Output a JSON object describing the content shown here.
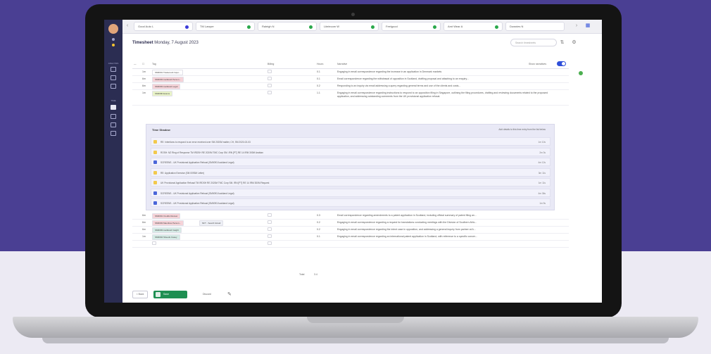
{
  "page": {
    "title_bold": "Timesheet",
    "title_date": "Monday, 7 August 2023",
    "search_placeholder": "Search timesheets"
  },
  "tabs": [
    {
      "label": "Good Auto L",
      "color": "#3b3bd9"
    },
    {
      "label": "TM Lawyer",
      "color": "#2aa84b"
    },
    {
      "label": "Raleigh N",
      "color": "#2aa84b"
    },
    {
      "label": "Litelecom W",
      "color": "#2aa84b"
    },
    {
      "label": "Feelgood",
      "color": "#2aa84b"
    },
    {
      "label": "Amt Wear A",
      "color": "#2aa84b"
    },
    {
      "label": "Downies N",
      "color": ""
    }
  ],
  "sidebar": {
    "sections": [
      "ANALYSIS",
      "TIME"
    ]
  },
  "table": {
    "headers": [
      "Tag",
      "Billing",
      "Hours",
      "Narrative"
    ],
    "toggle_label": "Show narratives",
    "rows_top": [
      {
        "n": "1m",
        "tag": "SM0001 Trademark Inqui...",
        "tag_color": "#ffffff",
        "hours": "0.1",
        "narrative": "Engaging in email correspondence regarding the increase in an application in Denmark markets"
      },
      {
        "n": "6m",
        "tag": "SM0093 Auckland Person...",
        "tag_color": "#f6d3d8",
        "hours": "0.1",
        "narrative": "Email correspondence regarding the withdrawal of opposition in Scotland, drafting proposal and attaching to an enquiry..."
      },
      {
        "n": "6m",
        "tag": "SM0093 Auckland Legal",
        "tag_color": "#f6d3d8",
        "hours": "0.2",
        "narrative": "Responding to an inquiry via email addressing a query regarding general terms and use of the clients and costs..."
      },
      {
        "n": "1m",
        "tag": "SM0090 Exams",
        "tag_color": "#e9f3c8",
        "hours": "1.1",
        "narrative": "Engaging in email correspondence regarding instructions to respond to an opposition filing in Singapore, outlining the filing procedures, drafting and reviewing documents related to the proposed application, and addressing outstanding comments from the UK provisional application refusal."
      }
    ],
    "shadow": {
      "title": "Time Shadow",
      "note": "Add details to this time entry from the list below",
      "items": [
        {
          "text": "RE: Intentions to respond to an error received over SM 2020M matter, CH, SM 2020-02-03",
          "time": "1m 10s",
          "icon_color": "#f2c94c"
        },
        {
          "text": "ROSH: NZ Ring of Response TM IRDSH RE 2020M TMC Corp SM. IRN [PT] RE 14 IRM 300M Arabian",
          "time": "2m 3s",
          "icon_color": "#f2c94c"
        },
        {
          "text": "SCREENS - UK Provisional Application Refusal (SM0093 Auckland Legal)",
          "time": "4m 12s",
          "icon_color": "#4a66d9"
        },
        {
          "text": "RE: Application Exercise (SM 0093M Letter)",
          "time": "3m 11s",
          "icon_color": "#f2c94c"
        },
        {
          "text": "UK Provisional Application Refusal TM IRDSH RE 2020M TMC Corp SM. IRN [PT] RE 14 IRM 300M Request",
          "time": "1m 11s",
          "icon_color": "#f2c94c"
        },
        {
          "text": "SCREENS - UK Provisional Application Refusal (SM0093 Auckland Legal)",
          "time": "4m 36s",
          "icon_color": "#4a66d9"
        },
        {
          "text": "SCREENS - UK Provisional Application Refusal (SM0093 Auckland Legal)",
          "time": "1m 9s",
          "icon_color": "#4a66d9"
        }
      ]
    },
    "rows_bottom": [
      {
        "n": "6m",
        "tag": "SM0091 Credits Review",
        "tag_color": "#f6d3d8",
        "tag2": "",
        "hours": "0.3",
        "narrative": "Email correspondence regarding amendments to a patent application in Scotland, including official summary of patent filing an..."
      },
      {
        "n": "6m",
        "tag": "SM0093 Mauritius Person...",
        "tag_color": "#f6d3d8",
        "tag2": "NFT - Search Email",
        "hours": "0.2",
        "narrative": "Engaging in email correspondence regarding a request for translations conducting meetings with the Division of Southern Afric..."
      },
      {
        "n": "6m",
        "tag": "SM0093 Auckland Insight",
        "tag_color": "#d6ece6",
        "tag2": "",
        "hours": "0.2",
        "narrative": "Engaging in email correspondence regarding the intent case in opposition, and addressing a general inquiry from partner at A..."
      },
      {
        "n": "1m",
        "tag": "SM0094 Sheeds Casey",
        "tag_color": "#d6ece6",
        "tag2": "",
        "hours": "0.1",
        "narrative": "Engaging in email correspondence regarding an international patent application in Scotland, with reference to a specific concer..."
      }
    ],
    "total_label": "Total",
    "total_value": "3.4"
  },
  "footer": {
    "back_label": "< Back",
    "save_label": "Save",
    "discard_label": "Discard"
  }
}
